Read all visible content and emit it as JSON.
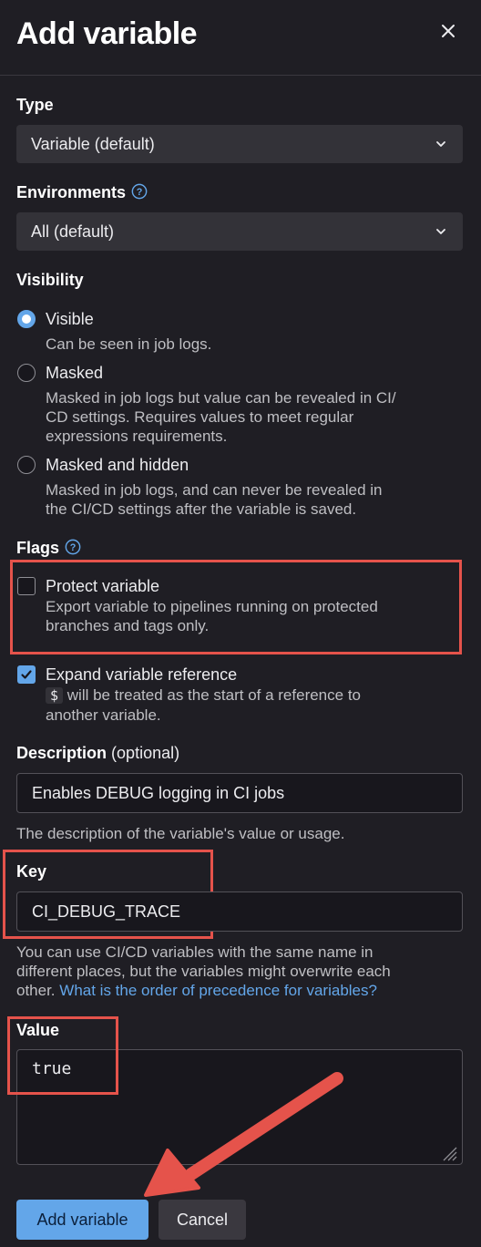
{
  "header": {
    "title": "Add variable",
    "close_icon": "close-icon"
  },
  "type": {
    "label": "Type",
    "selected": "Variable (default)"
  },
  "environments": {
    "label": "Environments",
    "selected": "All (default)"
  },
  "visibility": {
    "label": "Visibility",
    "options": [
      {
        "title": "Visible",
        "desc": "Can be seen in job logs.",
        "selected": true
      },
      {
        "title": "Masked",
        "desc_line1": "Masked in job logs but value can be revealed in CI/",
        "desc_line2": "CD settings. Requires values to meet regular",
        "desc_line3": "expressions requirements.",
        "selected": false
      },
      {
        "title": "Masked and hidden",
        "desc_line1": "Masked in job logs, and can never be revealed in",
        "desc_line2": "the CI/CD settings after the variable is saved.",
        "selected": false
      }
    ]
  },
  "flags": {
    "label": "Flags",
    "protect": {
      "title": "Protect variable",
      "desc_line1": "Export variable to pipelines running on protected",
      "desc_line2": "branches and tags only.",
      "checked": false
    },
    "expand": {
      "title": "Expand variable reference",
      "code": "$",
      "desc_line1_rest": "will be treated as the start of a reference to",
      "desc_line2": "another variable.",
      "checked": true
    }
  },
  "description": {
    "label": "Description",
    "optional": "(optional)",
    "value": "Enables DEBUG logging in CI jobs",
    "help": "The description of the variable's value or usage."
  },
  "key": {
    "label": "Key",
    "value": "CI_DEBUG_TRACE",
    "help_line1": "You can use CI/CD variables with the same name in",
    "help_line2": "different places, but the variables might overwrite each",
    "help_line3_text": "other.",
    "help_link": "What is the order of precedence for variables?"
  },
  "value": {
    "label": "Value",
    "text": "true"
  },
  "buttons": {
    "add": "Add variable",
    "cancel": "Cancel"
  },
  "colors": {
    "accent": "#63a6e9",
    "highlight": "#e5534b",
    "background": "#1f1e24"
  }
}
